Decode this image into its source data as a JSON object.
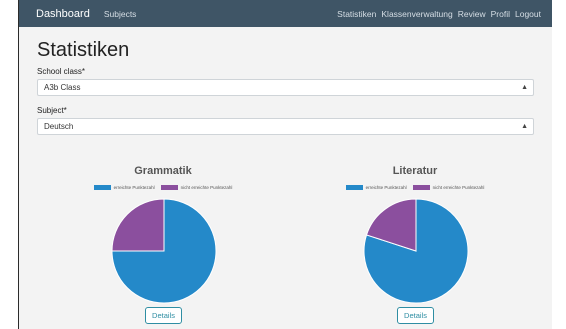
{
  "colors": {
    "navbar": "#3f5566",
    "series_reached": "#2489c9",
    "series_not_reached": "#8b4f9e",
    "details_button": "#2f8ea3"
  },
  "navbar": {
    "brand": "Dashboard",
    "left_links": [
      "Subjects"
    ],
    "right_links": [
      "Statistiken",
      "Klassenverwaltung",
      "Review",
      "Profil",
      "Logout"
    ]
  },
  "page": {
    "title": "Statistiken",
    "school_class": {
      "label": "School class*",
      "value": "A3b Class"
    },
    "subject": {
      "label": "Subject*",
      "value": "Deutsch"
    }
  },
  "charts": [
    {
      "title": "Grammatik",
      "legend": [
        "erreichte Punktezahl",
        "nicht erreichte Punktezahl"
      ],
      "details_label": "Details"
    },
    {
      "title": "Literatur",
      "legend": [
        "erreichte Punktezahl",
        "nicht erreichte Punktezahl"
      ],
      "details_label": "Details"
    }
  ],
  "chart_data": [
    {
      "type": "pie",
      "title": "Grammatik",
      "categories": [
        "erreichte Punktezahl",
        "nicht erreichte Punktezahl"
      ],
      "values": [
        75,
        25
      ],
      "legend": "top"
    },
    {
      "type": "pie",
      "title": "Literatur",
      "categories": [
        "erreichte Punktezahl",
        "nicht erreichte Punktezahl"
      ],
      "values": [
        80,
        20
      ],
      "legend": "top"
    }
  ]
}
